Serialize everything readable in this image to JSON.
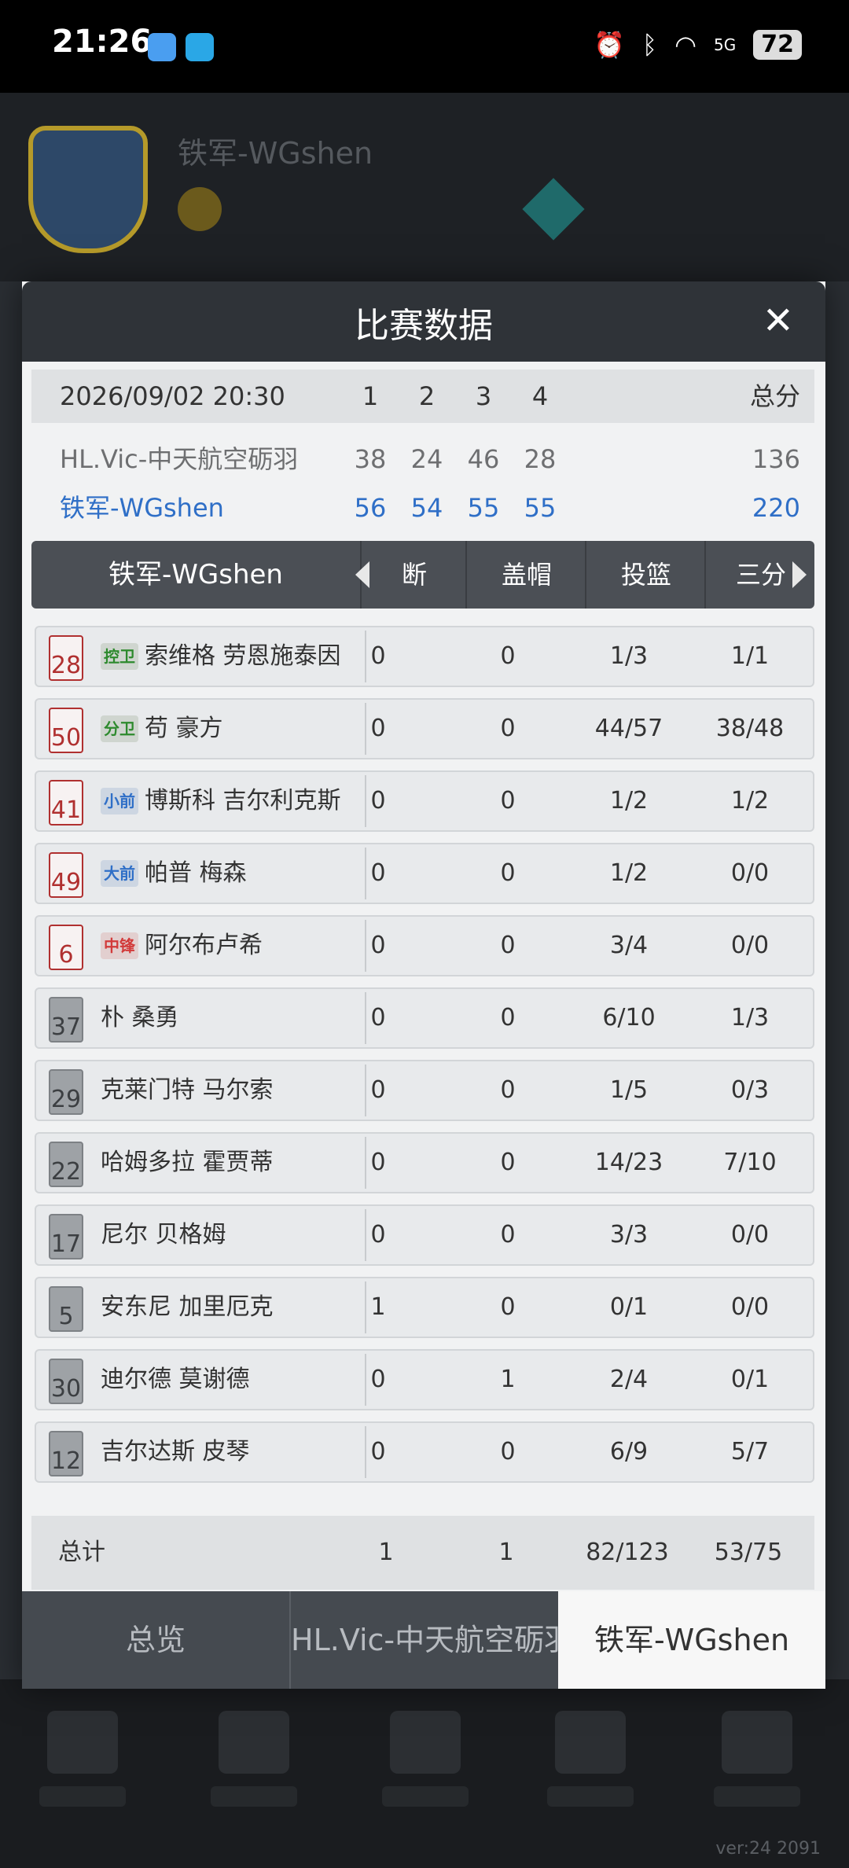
{
  "status_bar": {
    "time": "21:26",
    "battery": "72",
    "signal": "5G"
  },
  "background_app": {
    "team_name": "铁军-WGshen",
    "version": "ver:24  2091"
  },
  "modal": {
    "title": "比赛数据",
    "close_symbol": "✕"
  },
  "scoreboard": {
    "date": "2026/09/02 20:30",
    "quarters": [
      "1",
      "2",
      "3",
      "4"
    ],
    "total_label": "总分",
    "away": {
      "name": "HL.Vic-中天航空砺羽",
      "q": [
        "38",
        "24",
        "46",
        "28"
      ],
      "total": "136"
    },
    "home": {
      "name": "铁军-WGshen",
      "q": [
        "56",
        "54",
        "55",
        "55"
      ],
      "total": "220"
    }
  },
  "stats_table": {
    "team": "铁军-WGshen",
    "columns": [
      "抢断",
      "盖帽",
      "投篮",
      "三分"
    ],
    "columns_visible": [
      "断",
      "盖帽",
      "投篮",
      "三分"
    ],
    "players": [
      {
        "number": "28",
        "pos": "控卫",
        "name": "索维格 劳恩施泰因",
        "stl": "0",
        "blk": "0",
        "fg": "1/3",
        "tp": "1/1"
      },
      {
        "number": "50",
        "pos": "分卫",
        "name": "苟 豪方",
        "stl": "0",
        "blk": "0",
        "fg": "44/57",
        "tp": "38/48"
      },
      {
        "number": "41",
        "pos": "小前",
        "name": "博斯科 吉尔利克斯",
        "stl": "0",
        "blk": "0",
        "fg": "1/2",
        "tp": "1/2"
      },
      {
        "number": "49",
        "pos": "大前",
        "name": "帕普 梅森",
        "stl": "0",
        "blk": "0",
        "fg": "1/2",
        "tp": "0/0"
      },
      {
        "number": "6",
        "pos": "中锋",
        "name": "阿尔布卢希",
        "stl": "0",
        "blk": "0",
        "fg": "3/4",
        "tp": "0/0"
      },
      {
        "number": "37",
        "pos": "",
        "name": "朴 桑勇",
        "stl": "0",
        "blk": "0",
        "fg": "6/10",
        "tp": "1/3"
      },
      {
        "number": "29",
        "pos": "",
        "name": "克莱门特 马尔索",
        "stl": "0",
        "blk": "0",
        "fg": "1/5",
        "tp": "0/3"
      },
      {
        "number": "22",
        "pos": "",
        "name": "哈姆多拉 霍贾蒂",
        "stl": "0",
        "blk": "0",
        "fg": "14/23",
        "tp": "7/10"
      },
      {
        "number": "17",
        "pos": "",
        "name": "尼尔 贝格姆",
        "stl": "0",
        "blk": "0",
        "fg": "3/3",
        "tp": "0/0"
      },
      {
        "number": "5",
        "pos": "",
        "name": "安东尼 加里厄克",
        "stl": "1",
        "blk": "0",
        "fg": "0/1",
        "tp": "0/0"
      },
      {
        "number": "30",
        "pos": "",
        "name": "迪尔德 莫谢德",
        "stl": "0",
        "blk": "1",
        "fg": "2/4",
        "tp": "0/1"
      },
      {
        "number": "12",
        "pos": "",
        "name": "吉尔达斯 皮琴",
        "stl": "0",
        "blk": "0",
        "fg": "6/9",
        "tp": "5/7"
      }
    ],
    "total": {
      "label": "总计",
      "stl": "1",
      "blk": "1",
      "fg": "82/123",
      "tp": "53/75"
    }
  },
  "tabs": [
    {
      "label": "总览"
    },
    {
      "label": "HL.Vic-中天航空砺羽"
    },
    {
      "label": "铁军-WGshen"
    }
  ]
}
